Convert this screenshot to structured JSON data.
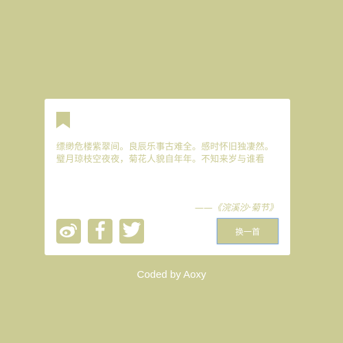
{
  "quote": {
    "lines": [
      "缥缈危楼紫翠间。良辰乐事古难全。感时怀旧独凄然。",
      "璧月琼枝空夜夜，菊花人貌自年年。不知来岁与谁看"
    ],
    "source": "——《浣溪沙·菊节》"
  },
  "icons": {
    "bookmark": "bookmark-icon",
    "weibo": "weibo-icon",
    "facebook": "facebook-icon",
    "twitter": "twitter-icon"
  },
  "buttons": {
    "next_label": "换一首"
  },
  "footer": {
    "credit": "Coded by Aoxy"
  },
  "colors": {
    "background": "#cbcb94",
    "card": "#ffffff",
    "accent": "#cbcb94",
    "button_border": "#7fa8d8"
  }
}
